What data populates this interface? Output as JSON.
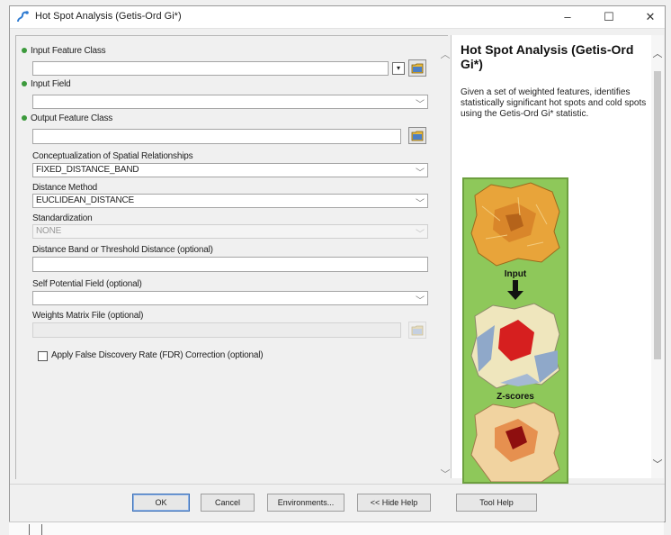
{
  "window": {
    "title": "Hot Spot Analysis (Getis-Ord Gi*)",
    "minimize": "–",
    "maximize": "☐",
    "close": "✕"
  },
  "params": {
    "input_feature_class": {
      "label": "Input Feature Class",
      "value": ""
    },
    "input_field": {
      "label": "Input Field",
      "value": ""
    },
    "output_feature_class": {
      "label": "Output Feature Class",
      "value": ""
    },
    "conceptualization": {
      "label": "Conceptualization of Spatial Relationships",
      "value": "FIXED_DISTANCE_BAND"
    },
    "distance_method": {
      "label": "Distance Method",
      "value": "EUCLIDEAN_DISTANCE"
    },
    "standardization": {
      "label": "Standardization",
      "value": "NONE"
    },
    "distance_band": {
      "label": "Distance Band or Threshold Distance (optional)",
      "value": ""
    },
    "self_potential": {
      "label": "Self Potential Field (optional)",
      "value": ""
    },
    "weights_matrix": {
      "label": "Weights Matrix File (optional)",
      "value": ""
    },
    "fdr": {
      "label": "Apply False Discovery Rate (FDR) Correction (optional)",
      "checked": false
    }
  },
  "help": {
    "title": "Hot Spot Analysis (Getis-Ord Gi*)",
    "description": "Given a set of weighted features, identifies statistically significant hot spots and cold spots using the Getis-Ord Gi* statistic.",
    "illustration_labels": {
      "input": "Input",
      "zscores": "Z-scores"
    }
  },
  "buttons": {
    "ok": "OK",
    "cancel": "Cancel",
    "environments": "Environments...",
    "hide_help": "<< Hide Help",
    "tool_help": "Tool Help"
  },
  "colors": {
    "required_dot": "#3c9a3c",
    "illustration_bg": "#8ec85a",
    "hot": "#d61f1f",
    "cold": "#8fa8c9"
  }
}
